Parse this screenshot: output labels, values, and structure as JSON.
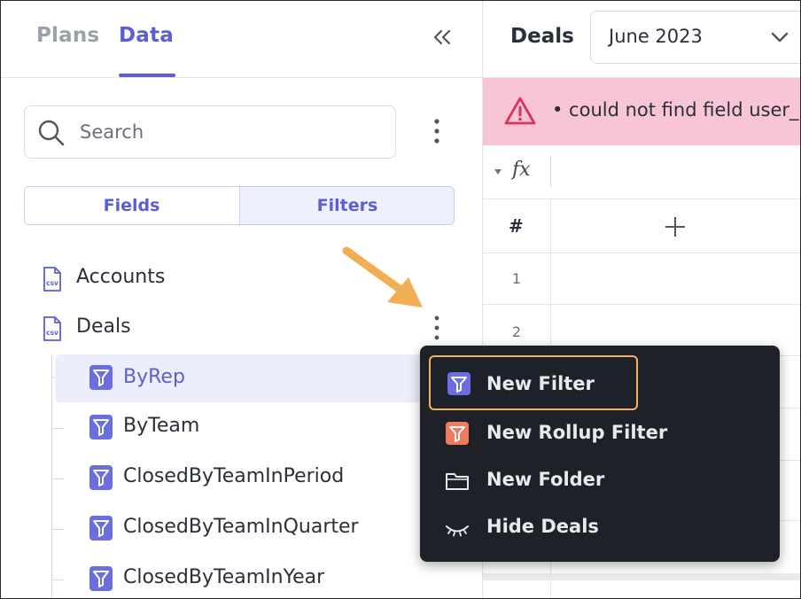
{
  "left_panel": {
    "tabs": [
      {
        "label": "Plans",
        "active": false
      },
      {
        "label": "Data",
        "active": true
      }
    ],
    "search": {
      "placeholder": "Search",
      "value": ""
    },
    "segments": [
      {
        "label": "Fields",
        "active": false
      },
      {
        "label": "Filters",
        "active": true
      }
    ],
    "tree": {
      "datasets": [
        {
          "label": "Accounts",
          "icon": "csv-file-icon"
        },
        {
          "label": "Deals",
          "icon": "csv-file-icon"
        }
      ],
      "filters": [
        {
          "label": "ByRep",
          "selected": true
        },
        {
          "label": "ByTeam",
          "selected": false
        },
        {
          "label": "ClosedByTeamInPeriod",
          "selected": false
        },
        {
          "label": "ClosedByTeamInQuarter",
          "selected": false
        },
        {
          "label": "ClosedByTeamInYear",
          "selected": false
        }
      ]
    }
  },
  "right_panel": {
    "title": "Deals",
    "period": {
      "value": "June 2023"
    },
    "error": {
      "text": "• could not find field user_"
    },
    "formula": {
      "icon_text": "fx"
    },
    "grid": {
      "corner_label": "#",
      "rows": [
        "1",
        "2"
      ]
    }
  },
  "context_menu": {
    "items": [
      {
        "label": "New Filter",
        "icon": "filter-icon",
        "highlighted": true
      },
      {
        "label": "New Rollup Filter",
        "icon": "rollup-filter-icon",
        "highlighted": false
      },
      {
        "label": "New Folder",
        "icon": "folder-icon",
        "highlighted": false
      },
      {
        "label": "Hide Deals",
        "icon": "eye-closed-icon",
        "highlighted": false
      }
    ]
  },
  "colors": {
    "accent": "#5b5fd6",
    "error_bg": "#f7c5d6",
    "error_icon": "#d8335b",
    "menu_bg": "#1e2228",
    "highlight": "#f2b35c",
    "annotation_arrow": "#f3ad55",
    "rollup_icon": "#f07a5c"
  }
}
